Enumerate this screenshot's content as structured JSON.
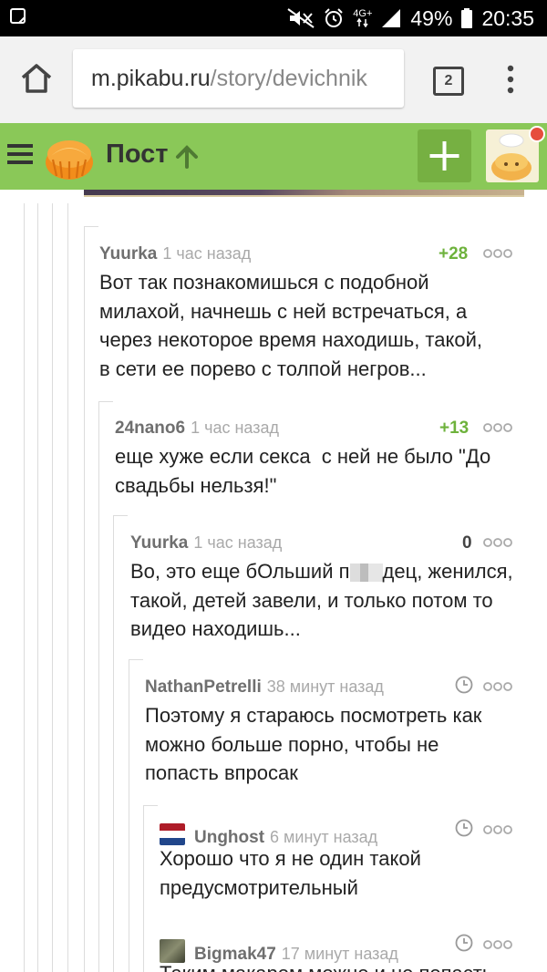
{
  "status_bar": {
    "network": "4G+",
    "battery": "49%",
    "time": "20:35"
  },
  "browser": {
    "url_host": "m.pikabu.ru",
    "url_path": "/story/devichnik",
    "tab_count": "2"
  },
  "header": {
    "title": "Пост"
  },
  "comments": [
    {
      "author": "Yuurka",
      "time": "1 час назад",
      "rating": "+28",
      "lines": [
        "Вот так познакомишься с подобной",
        "милахой, начнешь с ней встречаться, а",
        "через некоторое время находишь, такой,",
        "в сети ее порево с толпой негров..."
      ]
    },
    {
      "author": "24nano6",
      "time": "1 час назад",
      "rating": "+13",
      "lines": [
        "еще хуже если секса  с ней не было \"До",
        "свадьбы нельзя!\""
      ]
    },
    {
      "author": "Yuurka",
      "time": "1 час назад",
      "rating": "0",
      "line1_before": "Во, это еще бОльший п",
      "line1_after": "дец, женился,",
      "lines": [
        "такой, детей завели, и только потом то",
        "видео находишь..."
      ]
    },
    {
      "author": "NathanPetrelli",
      "time": "38 минут назад",
      "lines": [
        "Поэтому я стараюсь посмотреть как",
        "можно больше порно, чтобы не",
        "попасть впросак"
      ]
    },
    {
      "author": "Unghost",
      "time": "6 минут назад",
      "lines": [
        "Хорошо что я не один такой",
        "предусмотрительный"
      ]
    },
    {
      "author": "Bigmak47",
      "time": "17 минут назад",
      "lines": [
        "Таким макаром можно и не попасть"
      ]
    }
  ],
  "colors": {
    "header_green": "#8ac858",
    "plus_green": "#76b042",
    "rating_positive": "#6eb23c"
  }
}
